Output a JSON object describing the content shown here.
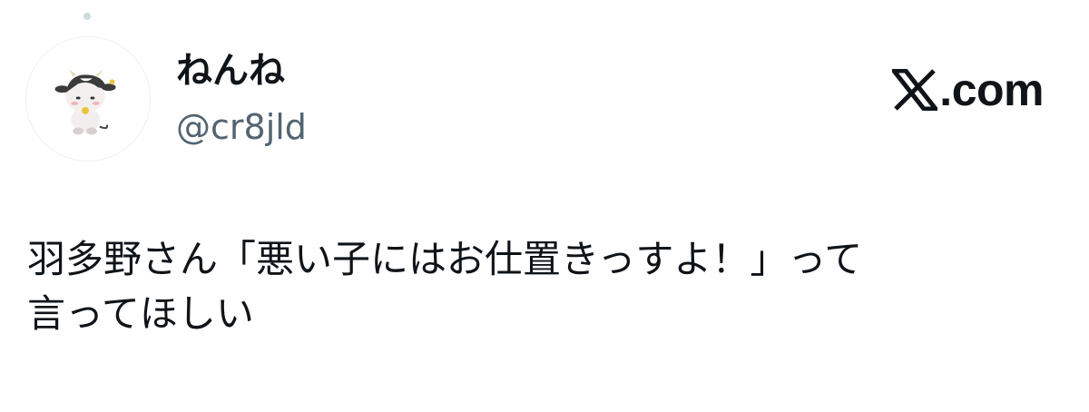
{
  "author": {
    "display_name": "ねんね",
    "handle": "@cr8jld",
    "avatar_icon": "cow-character-avatar-icon"
  },
  "brand": {
    "icon": "x-logo-icon",
    "text": ".com"
  },
  "tweet": {
    "text": "羽多野さん「悪い子にはお仕置きっすよ！」って\n言ってほしい"
  },
  "colors": {
    "text_primary": "#0f1419",
    "text_secondary": "#536471",
    "background": "#ffffff"
  }
}
